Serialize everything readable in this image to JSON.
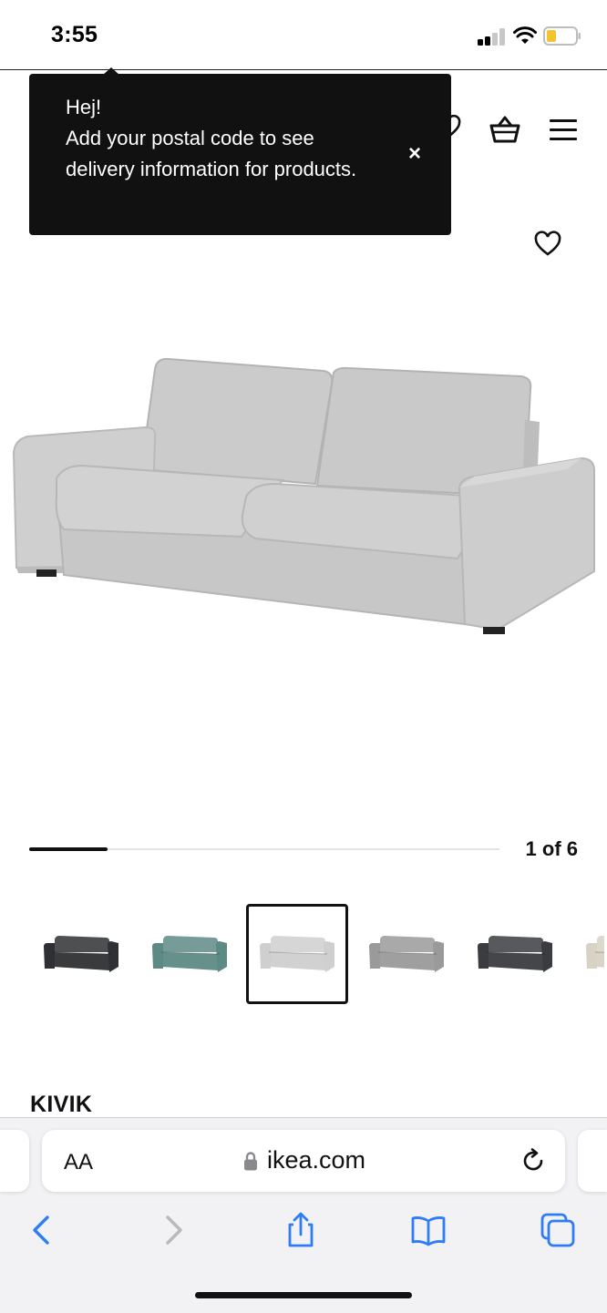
{
  "status_bar": {
    "time": "3:55"
  },
  "header": {
    "icons": [
      "heart-icon",
      "basket-icon",
      "hamburger-menu-icon"
    ]
  },
  "tooltip": {
    "greeting": "Hej!",
    "message": "Add your postal code to see delivery information for products.",
    "close_label": "×"
  },
  "gallery": {
    "counter": "1 of 6",
    "current_index": 1,
    "total": 6,
    "progress_fraction": 0.167
  },
  "variants": [
    {
      "name": "anthracite-sofa",
      "color": "#2e3033",
      "selected": false
    },
    {
      "name": "teal-sofa",
      "color": "#5e8a86",
      "selected": false
    },
    {
      "name": "light-grey-sofa",
      "color": "#cfcfcf",
      "selected": true
    },
    {
      "name": "medium-grey-sofa",
      "color": "#9a9a9a",
      "selected": false
    },
    {
      "name": "dark-grey-sofa",
      "color": "#3a3c3f",
      "selected": false
    },
    {
      "name": "beige-sofa",
      "color": "#d8d2c4",
      "selected": false
    }
  ],
  "product": {
    "name": "KIVIK"
  },
  "browser": {
    "aa_label": "AA",
    "url": "ikea.com",
    "toolbar": [
      "back-icon",
      "forward-icon",
      "share-icon",
      "bookmarks-icon",
      "tabs-icon"
    ]
  },
  "colors": {
    "tooltip_bg": "#111111",
    "sofa_fabric": "#cfcfcf",
    "safari_blue": "#2f7df6"
  }
}
